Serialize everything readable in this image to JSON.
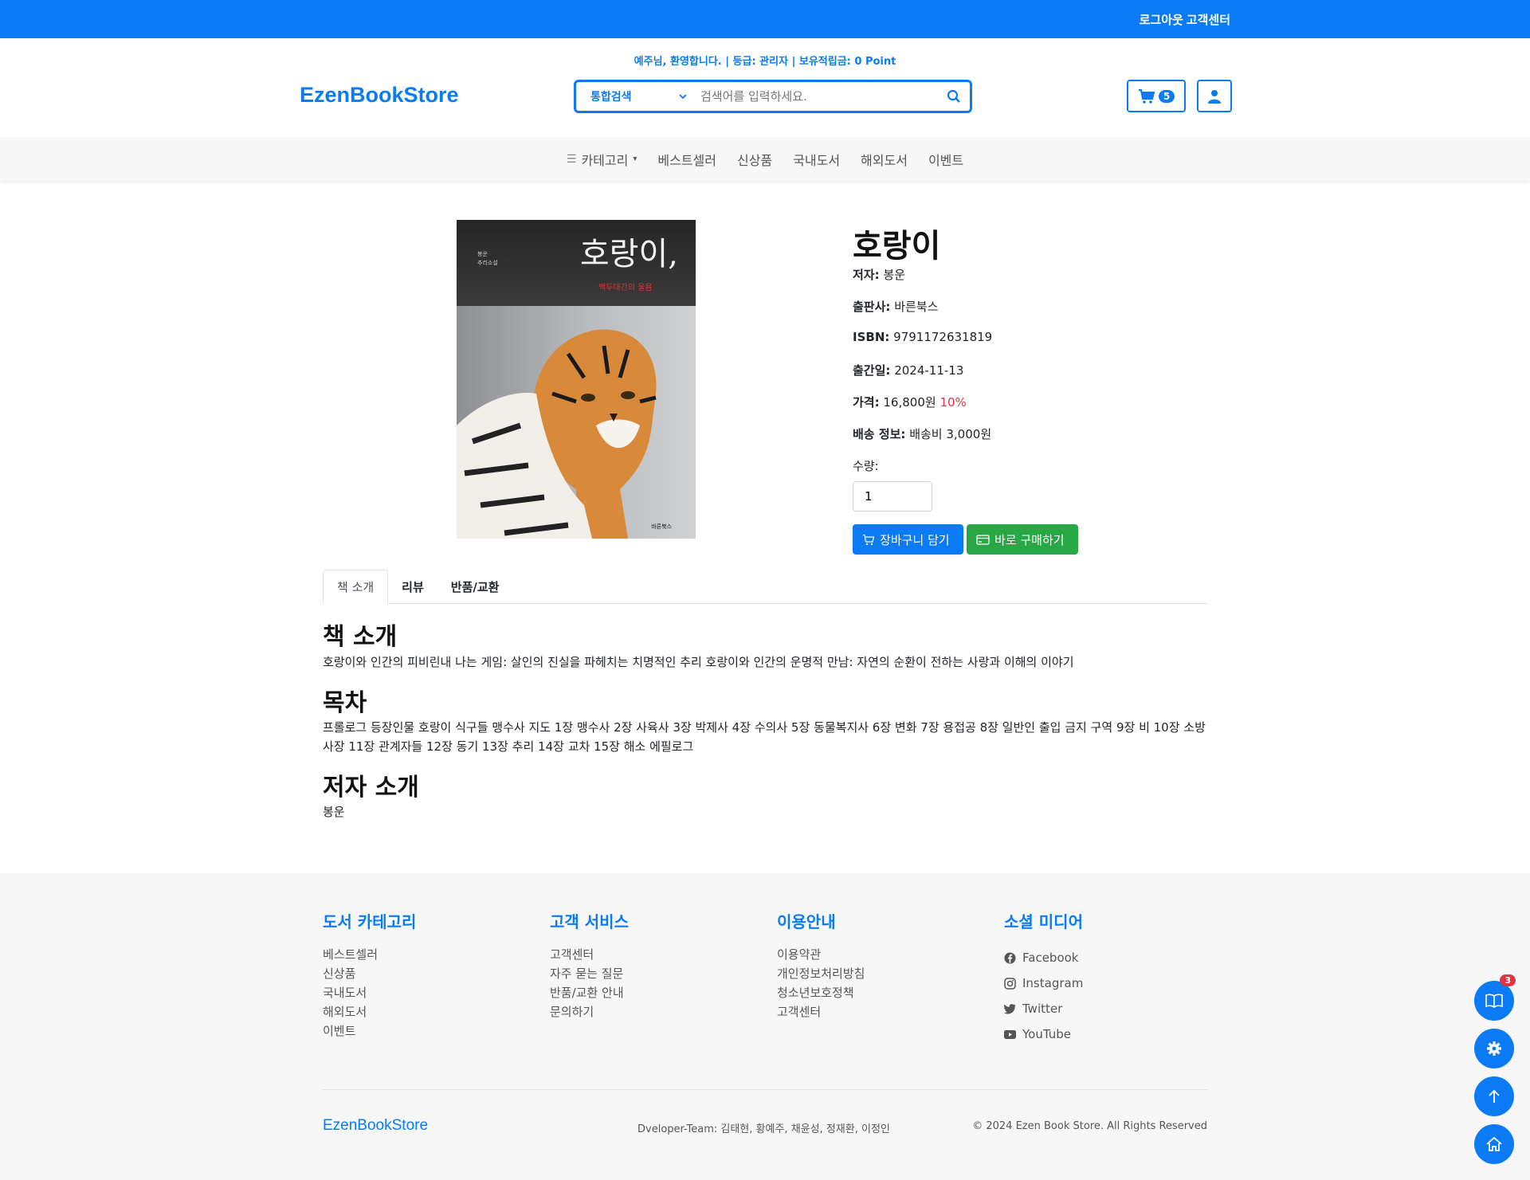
{
  "topbar": {
    "logout": "로그아웃",
    "customer_center": "고객센터"
  },
  "header": {
    "welcome": "예주님, 환영합니다. | 등급: 관리자 | 보유적립금: 0 Point",
    "logo": "EzenBookStore",
    "search": {
      "scope": "통합검색",
      "placeholder": "검색어를 입력하세요."
    },
    "cart_count": "5"
  },
  "nav": {
    "items": [
      "카테고리",
      "베스트셀러",
      "신상품",
      "국내도서",
      "해외도서",
      "이벤트"
    ]
  },
  "book": {
    "cover_title": "호랑이,",
    "cover_subtitle": "백두대간의 울음",
    "cover_author": "봉운",
    "cover_genre": "추리소설",
    "cover_publisher": "바른북스",
    "title": "호랑이",
    "author_label": "저자:",
    "author": "봉운",
    "publisher_label": "출판사:",
    "publisher": "바른북스",
    "isbn_label": "ISBN:",
    "isbn": "9791172631819",
    "date_label": "출간일:",
    "date": "2024-11-13",
    "price_label": "가격:",
    "price": "16,800원",
    "discount": "10%",
    "shipping_label": "배송 정보:",
    "shipping": "배송비 3,000원",
    "qty_label": "수량:",
    "qty": "1",
    "cart_button": "장바구니 담기",
    "buy_button": "바로 구매하기"
  },
  "tabs": [
    "책 소개",
    "리뷰",
    "반품/교환"
  ],
  "content": {
    "intro_heading": "책 소개",
    "intro_text": "호랑이와 인간의 피비린내 나는 게임: 살인의 진실을 파헤치는 치명적인 추리 호랑이와 인간의 운명적 만남: 자연의 순환이 전하는 사랑과 이해의 이야기",
    "toc_heading": "목차",
    "toc_text": "프롤로그 등장인물 호랑이 식구들 맹수사 지도 1장 맹수사 2장 사육사 3장 박제사 4장 수의사 5장 동물복지사 6장 변화 7장 용접공 8장 일반인 출입 금지 구역 9장 비 10장 소방사장 11장 관계자들 12장 동기 13장 추리 14장 교차 15장 해소 에필로그",
    "author_heading": "저자 소개",
    "author_text": "봉운"
  },
  "footer": {
    "col1": {
      "title": "도서 카테고리",
      "links": [
        "베스트셀러",
        "신상품",
        "국내도서",
        "해외도서",
        "이벤트"
      ]
    },
    "col2": {
      "title": "고객 서비스",
      "links": [
        "고객센터",
        "자주 묻는 질문",
        "반품/교환 안내",
        "문의하기"
      ]
    },
    "col3": {
      "title": "이용안내",
      "links": [
        "이용약관",
        "개인정보처리방침",
        "청소년보호정책",
        "고객센터"
      ]
    },
    "col4": {
      "title": "소셜 미디어",
      "links": [
        "Facebook",
        "Instagram",
        "Twitter",
        "YouTube"
      ]
    },
    "brand": "EzenBookStore",
    "developers": "Dveloper-Team: 김태현, 황예주, 채윤성, 정재환, 이정인",
    "copyright": "© 2024 Ezen Book Store. All Rights Reserved"
  },
  "fab": {
    "recent_count": "3"
  },
  "colors": {
    "primary": "#0b7bf5",
    "success": "#28a745",
    "danger": "#dc3545"
  }
}
